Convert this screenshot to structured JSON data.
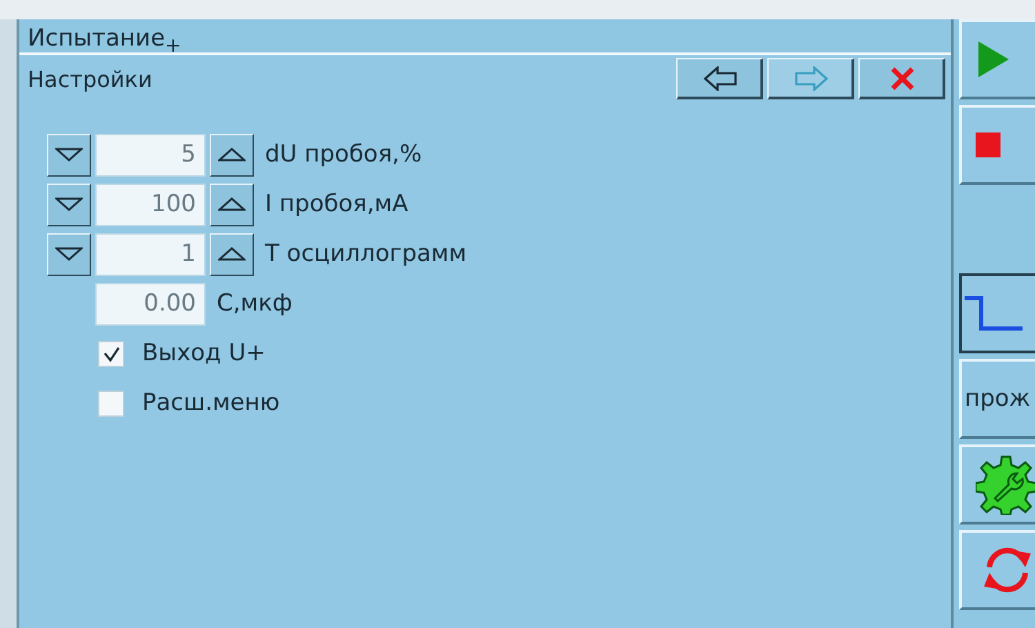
{
  "window": {
    "title": "Испытание$_{+}$"
  },
  "panel": {
    "title": "Настройки",
    "nav": [
      {
        "kind": "back",
        "disabled": false
      },
      {
        "kind": "forward",
        "disabled": true
      },
      {
        "kind": "close",
        "disabled": false
      }
    ]
  },
  "spinners": [
    {
      "value": "5",
      "label": "dU пробоя,%"
    },
    {
      "value": "100",
      "label": "I пробоя,мА"
    },
    {
      "value": "1",
      "label": "T осциллограмм"
    }
  ],
  "capacitance": {
    "value": "0.00",
    "label": "С,мкф"
  },
  "checkboxes": [
    {
      "label": "Выход U+",
      "checked": true
    },
    {
      "label": "Расш.меню",
      "checked": false
    }
  ],
  "side_buttons": [
    {
      "kind": "play"
    },
    {
      "kind": "stop"
    },
    {
      "kind": "gap"
    },
    {
      "kind": "waveform"
    },
    {
      "kind": "text",
      "label": "прож"
    },
    {
      "kind": "gear"
    },
    {
      "kind": "refresh"
    }
  ]
}
